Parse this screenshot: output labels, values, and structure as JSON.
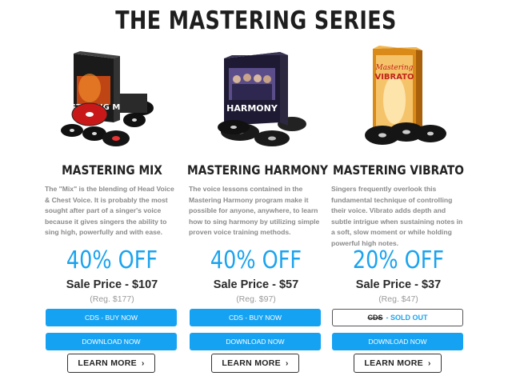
{
  "page": {
    "title": "THE MASTERING SERIES"
  },
  "products": [
    {
      "name": "MASTERING MIX",
      "description": "The \"Mix\" is the blending of Head Voice & Chest Voice. It is probably the most sought after part of a singer's voice because it gives singers the ability to sing high, powerfully and with ease.",
      "discount": "40% OFF",
      "sale_price": "Sale Price - $107",
      "regular_price": "(Reg. $177)",
      "cds_button": "CDS - BUY NOW",
      "download_button": "DOWNLOAD NOW",
      "learn_more": "LEARN MORE",
      "box_label": "MASTERING MIX"
    },
    {
      "name": "MASTERING HARMONY",
      "description": "The voice lessons contained in the Mastering Harmony program make it possible for anyone, anywhere, to learn how to sing harmony by utilizing simple proven voice training methods.",
      "discount": "40% OFF",
      "sale_price": "Sale Price - $57",
      "regular_price": "(Reg. $97)",
      "cds_button": "CDS - BUY NOW",
      "download_button": "DOWNLOAD NOW",
      "learn_more": "LEARN MORE",
      "box_label": "HARMONY"
    },
    {
      "name": "MASTERING VIBRATO",
      "description": "Singers frequently overlook this fundamental technique of controlling their voice. Vibrato adds depth and subtle intrigue when sustaining notes in a soft, slow moment or while holding powerful high notes.",
      "discount": "20% OFF",
      "sale_price": "Sale Price - $37",
      "regular_price": "(Reg. $47)",
      "cds_label": "CDS",
      "sold_out": "- SOLD OUT",
      "download_button": "DOWNLOAD NOW",
      "learn_more": "LEARN MORE",
      "box_label_top": "Mastering",
      "box_label_bottom": "VIBRATO"
    }
  ],
  "colors": {
    "accent": "#1aa3ef",
    "button_blue": "#16a2f2",
    "description_gray": "#8a8a8a"
  }
}
